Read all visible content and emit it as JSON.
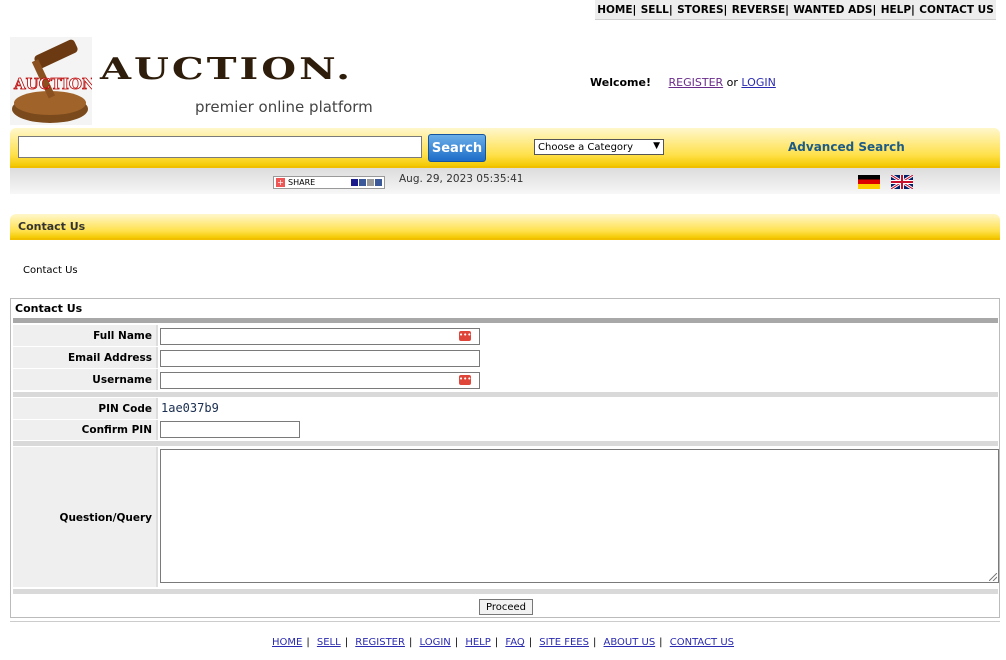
{
  "topnav": [
    {
      "label": "HOME|"
    },
    {
      "label": "SELL|"
    },
    {
      "label": "STORES|"
    },
    {
      "label": "REVERSE|"
    },
    {
      "label": "WANTED ADS|"
    },
    {
      "label": "HELP|"
    },
    {
      "label": "CONTACT US"
    }
  ],
  "header": {
    "logo_text": "AUCTION",
    "brand": "AUCTION.",
    "tagline": "premier online platform",
    "welcome": "Welcome!",
    "register": "REGISTER",
    "or": "or",
    "login": "LOGIN"
  },
  "search": {
    "button": "Search",
    "category": "Choose a Category",
    "advanced": "Advanced Search"
  },
  "info": {
    "share": "SHARE",
    "datetime": "Aug. 29, 2023 05:35:41"
  },
  "section": {
    "title": "Contact Us",
    "breadcrumb": "Contact Us"
  },
  "form": {
    "title": "Contact Us",
    "full_name": "Full Name",
    "email": "Email Address",
    "username": "Username",
    "pin_label": "PIN Code",
    "pin_value": "1ae037b9",
    "confirm_pin": "Confirm PIN",
    "query": "Question/Query",
    "proceed": "Proceed"
  },
  "footer": [
    {
      "label": "HOME"
    },
    {
      "label": "SELL"
    },
    {
      "label": "REGISTER"
    },
    {
      "label": "LOGIN"
    },
    {
      "label": "HELP"
    },
    {
      "label": "FAQ"
    },
    {
      "label": "SITE FEES"
    },
    {
      "label": "ABOUT US"
    },
    {
      "label": "CONTACT US"
    }
  ],
  "colors": {
    "yellow_bar": "#ffe14d",
    "search_button": "#1d6cc8",
    "link": "#2a2ab0",
    "brand": "#2e1d0a"
  }
}
